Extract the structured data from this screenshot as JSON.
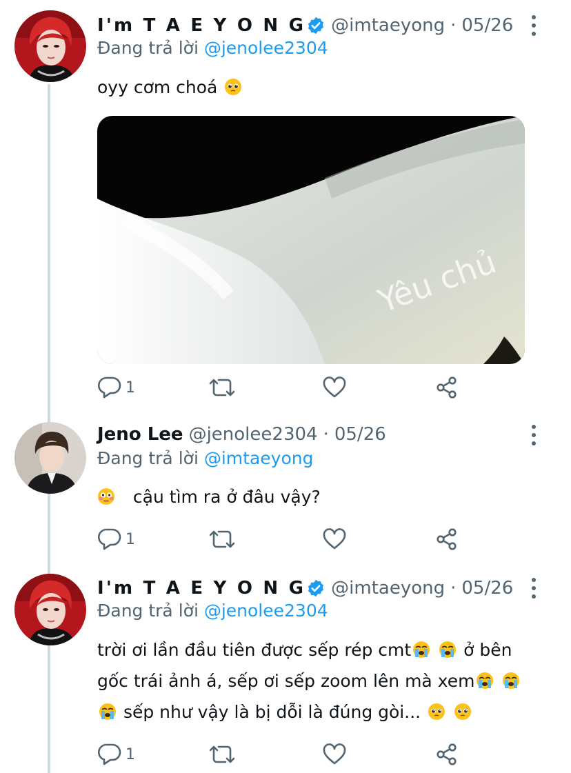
{
  "colors": {
    "accent": "#1d9bf0",
    "muted": "#536471",
    "text": "#0f1419",
    "thread_line": "#cfd9de"
  },
  "tweets": [
    {
      "name": "I'm T A E Y O N G",
      "verified": true,
      "handle": "@imtaeyong",
      "separator": "·",
      "date": "05/26",
      "replying_prefix": "Đang trả lời",
      "replying_to": "@jenolee2304",
      "text_parts": [
        "oyy cơm choá",
        ""
      ],
      "emojis": [
        "pleading-face"
      ],
      "media_watermark": "Yêu chủ",
      "reply_count": "1",
      "icons": [
        "reply-icon",
        "retweet-icon",
        "like-icon",
        "share-icon",
        "more-icon"
      ]
    },
    {
      "name": "Jeno Lee",
      "verified": false,
      "handle": "@jenolee2304",
      "separator": "·",
      "date": "05/26",
      "replying_prefix": "Đang trả lời",
      "replying_to": "@imtaeyong",
      "text_parts": [
        "",
        "cậu tìm ra ở đâu vậy?"
      ],
      "emojis": [
        "flushed-face"
      ],
      "reply_count": "1",
      "icons": [
        "reply-icon",
        "retweet-icon",
        "like-icon",
        "share-icon",
        "more-icon"
      ]
    },
    {
      "name": "I'm T A E Y O N G",
      "verified": true,
      "handle": "@imtaeyong",
      "separator": "·",
      "date": "05/26",
      "replying_prefix": "Đang trả lời",
      "replying_to": "@jenolee2304",
      "text_parts": [
        "trời ơi lần đầu tiên được sếp rép cmt",
        "ở bên gốc trái ảnh á, sếp ơi sếp zoom lên mà xem",
        "sếp như vậy là bị dỗi là đúng gòi..."
      ],
      "emojis": [
        "loudly-crying-face",
        "loudly-crying-face",
        "loudly-crying-face",
        "loudly-crying-face",
        "loudly-crying-face",
        "pleading-face",
        "pleading-face"
      ],
      "reply_count": "1",
      "icons": [
        "reply-icon",
        "retweet-icon",
        "like-icon",
        "share-icon",
        "more-icon"
      ]
    }
  ]
}
